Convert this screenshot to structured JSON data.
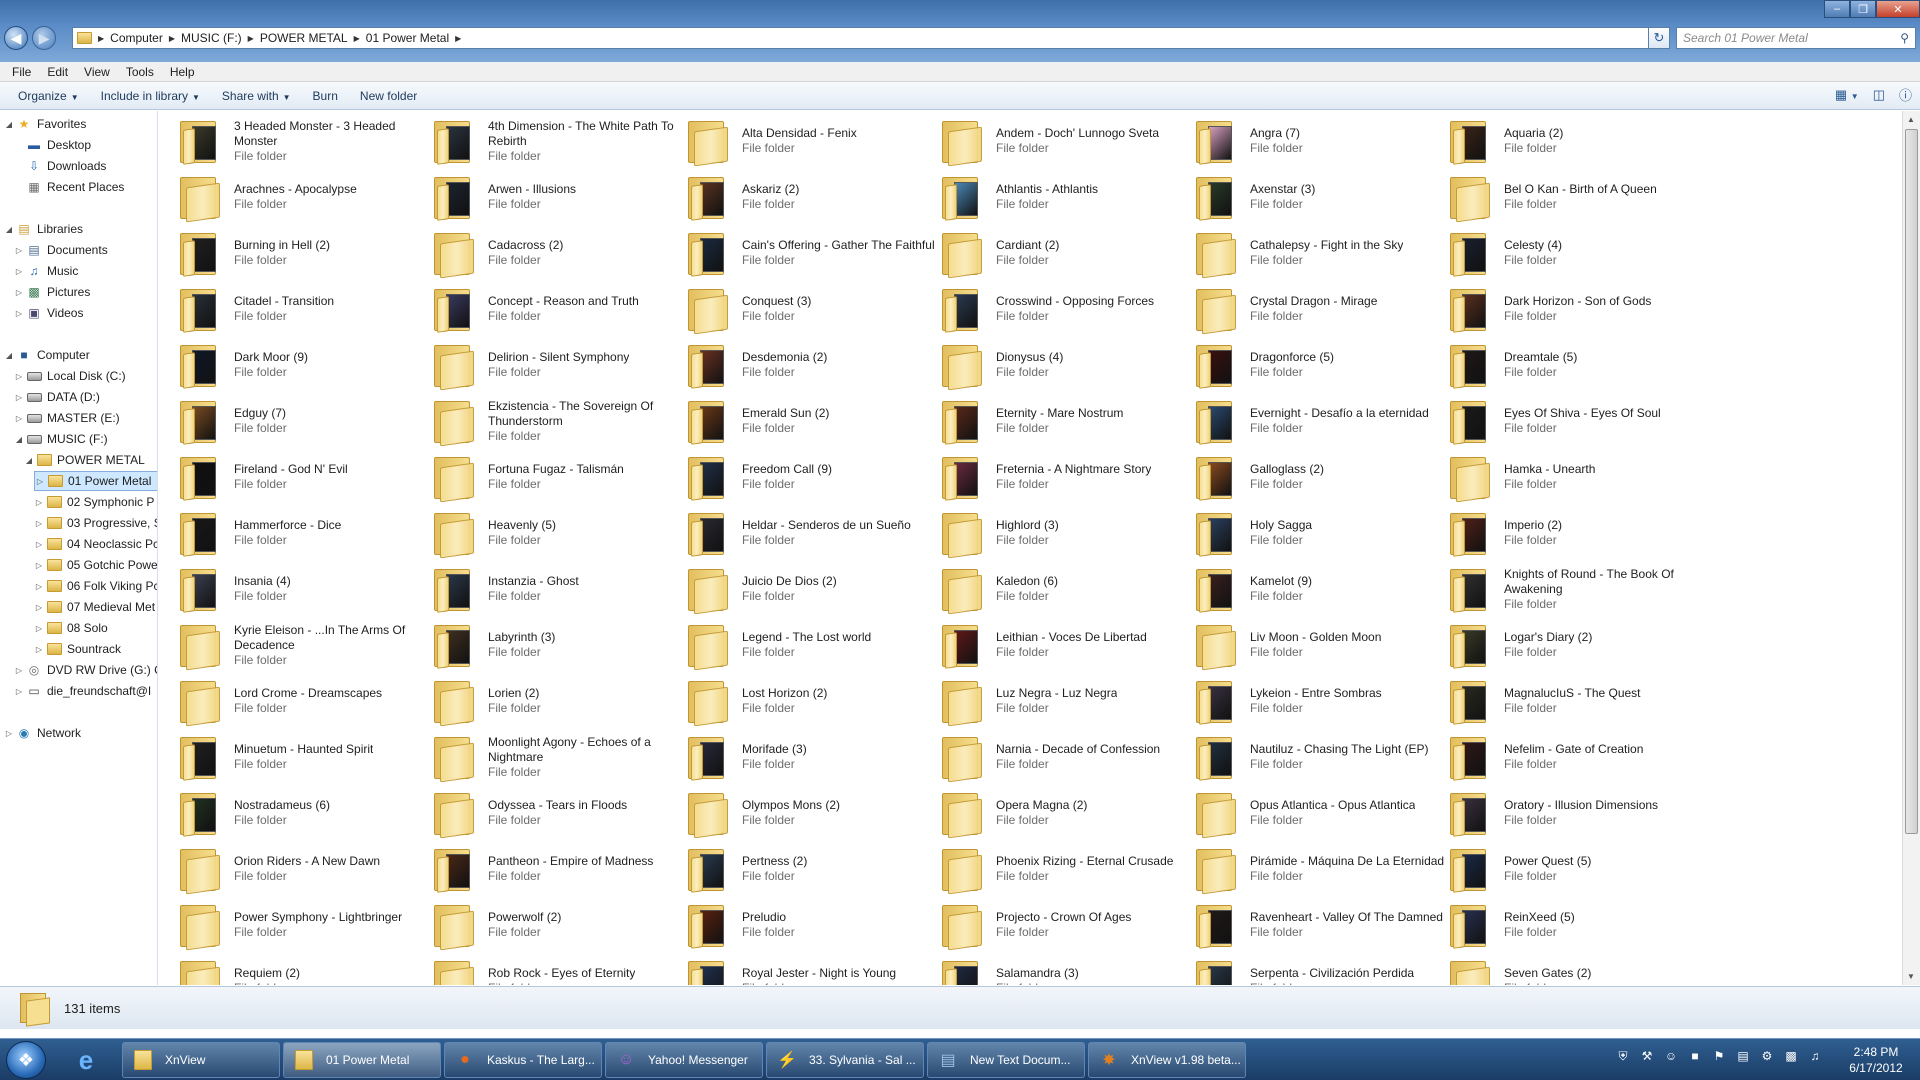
{
  "window": {
    "breadcrumb": [
      "Computer",
      "MUSIC (F:)",
      "POWER METAL",
      "01 Power Metal"
    ],
    "search_placeholder": "Search 01 Power Metal"
  },
  "menubar": [
    "File",
    "Edit",
    "View",
    "Tools",
    "Help"
  ],
  "commandbar": [
    {
      "label": "Organize",
      "dropdown": true
    },
    {
      "label": "Include in library",
      "dropdown": true
    },
    {
      "label": "Share with",
      "dropdown": true
    },
    {
      "label": "Burn",
      "dropdown": false
    },
    {
      "label": "New folder",
      "dropdown": false
    }
  ],
  "nav_tree": [
    {
      "label": "Favorites",
      "level": 0,
      "expander": "open",
      "icon": "star-icon"
    },
    {
      "label": "Desktop",
      "level": 1,
      "expander": "",
      "icon": "desktop-icon"
    },
    {
      "label": "Downloads",
      "level": 1,
      "expander": "",
      "icon": "downloads-icon"
    },
    {
      "label": "Recent Places",
      "level": 1,
      "expander": "",
      "icon": "recent-places-icon"
    },
    {
      "label": "",
      "level": 0,
      "expander": "",
      "icon": ""
    },
    {
      "label": "Libraries",
      "level": 0,
      "expander": "open",
      "icon": "libraries-icon"
    },
    {
      "label": "Documents",
      "level": 1,
      "expander": "closed",
      "icon": "documents-icon"
    },
    {
      "label": "Music",
      "level": 1,
      "expander": "closed",
      "icon": "music-icon"
    },
    {
      "label": "Pictures",
      "level": 1,
      "expander": "closed",
      "icon": "pictures-icon"
    },
    {
      "label": "Videos",
      "level": 1,
      "expander": "closed",
      "icon": "videos-icon"
    },
    {
      "label": "",
      "level": 0,
      "expander": "",
      "icon": ""
    },
    {
      "label": "Computer",
      "level": 0,
      "expander": "open",
      "icon": "computer-icon"
    },
    {
      "label": "Local Disk (C:)",
      "level": 1,
      "expander": "closed",
      "icon": "drive-icon"
    },
    {
      "label": "DATA (D:)",
      "level": 1,
      "expander": "closed",
      "icon": "drive-icon"
    },
    {
      "label": "MASTER (E:)",
      "level": 1,
      "expander": "closed",
      "icon": "drive-icon"
    },
    {
      "label": "MUSIC (F:)",
      "level": 1,
      "expander": "open",
      "icon": "drive-icon"
    },
    {
      "label": "POWER METAL",
      "level": 2,
      "expander": "open",
      "icon": "folder-icon"
    },
    {
      "label": "01 Power Metal",
      "level": 3,
      "expander": "closed",
      "icon": "folder-icon",
      "selected": true
    },
    {
      "label": "02 Symphonic P",
      "level": 3,
      "expander": "closed",
      "icon": "folder-icon"
    },
    {
      "label": "03 Progressive, S",
      "level": 3,
      "expander": "closed",
      "icon": "folder-icon"
    },
    {
      "label": "04 Neoclassic Pc",
      "level": 3,
      "expander": "closed",
      "icon": "folder-icon"
    },
    {
      "label": "05 Gotchic Powe",
      "level": 3,
      "expander": "closed",
      "icon": "folder-icon"
    },
    {
      "label": "06 Folk Viking Pc",
      "level": 3,
      "expander": "closed",
      "icon": "folder-icon"
    },
    {
      "label": "07 Medieval Met",
      "level": 3,
      "expander": "closed",
      "icon": "folder-icon"
    },
    {
      "label": "08 Solo",
      "level": 3,
      "expander": "closed",
      "icon": "folder-icon"
    },
    {
      "label": "Sountrack",
      "level": 3,
      "expander": "closed",
      "icon": "folder-icon"
    },
    {
      "label": "DVD RW Drive (G:) G",
      "level": 1,
      "expander": "closed",
      "icon": "dvd-drive-icon"
    },
    {
      "label": "die_freundschaft@I",
      "level": 1,
      "expander": "closed",
      "icon": "network-drive-icon"
    },
    {
      "label": "",
      "level": 0,
      "expander": "",
      "icon": ""
    },
    {
      "label": "Network",
      "level": 0,
      "expander": "closed",
      "icon": "network-icon"
    }
  ],
  "folder_type_label": "File folder",
  "items": [
    {
      "name": "3 Headed Monster - 3 Headed Monster",
      "art": "#3a3a2a"
    },
    {
      "name": "4th Dimension - The White Path To Rebirth",
      "art": "#2a3440"
    },
    {
      "name": "Alta Densidad - Fenix",
      "art": null
    },
    {
      "name": "Andem - Doch' Lunnogo Sveta",
      "art": null
    },
    {
      "name": "Angra (7)",
      "art": "#d8a0c0"
    },
    {
      "name": "Aquaria (2)",
      "art": "#3a2418"
    },
    {
      "name": "Arachnes - Apocalypse",
      "art": null
    },
    {
      "name": "Arwen - Illusions",
      "art": "#1c2430"
    },
    {
      "name": "Askariz (2)",
      "art": "#5a3420"
    },
    {
      "name": "Athlantis - Athlantis",
      "art": "#4a8ab8"
    },
    {
      "name": "Axenstar (3)",
      "art": "#2a3a2a"
    },
    {
      "name": "Bel O Kan - Birth of A Queen",
      "art": null
    },
    {
      "name": "Burning in Hell (2)",
      "art": "#202020"
    },
    {
      "name": "Cadacross (2)",
      "art": null
    },
    {
      "name": "Cain's Offering - Gather The Faithful",
      "art": "#1a2a40"
    },
    {
      "name": "Cardiant (2)",
      "art": null
    },
    {
      "name": "Cathalepsy - Fight in the Sky",
      "art": null
    },
    {
      "name": "Celesty (4)",
      "art": "#1a2030"
    },
    {
      "name": "Citadel - Transition",
      "art": "#283038"
    },
    {
      "name": "Concept - Reason and Truth",
      "art": "#3a3a60"
    },
    {
      "name": "Conquest (3)",
      "art": null
    },
    {
      "name": "Crosswind - Opposing Forces",
      "art": "#2a3a50"
    },
    {
      "name": "Crystal Dragon - Mirage",
      "art": null
    },
    {
      "name": "Dark Horizon - Son of Gods",
      "art": "#5a3020"
    },
    {
      "name": "Dark Moor (9)",
      "art": "#101828"
    },
    {
      "name": "Delirion - Silent Symphony",
      "art": null
    },
    {
      "name": "Desdemonia (2)",
      "art": "#6a3020"
    },
    {
      "name": "Dionysus (4)",
      "art": null
    },
    {
      "name": "Dragonforce (5)",
      "art": "#3a1010"
    },
    {
      "name": "Dreamtale (5)",
      "art": "#201818"
    },
    {
      "name": "Edguy (7)",
      "art": "#7a4a20"
    },
    {
      "name": "Ekzistencia - The Sovereign Of Thunderstorm",
      "art": null
    },
    {
      "name": "Emerald Sun (2)",
      "art": "#6a3818"
    },
    {
      "name": "Eternity - Mare Nostrum",
      "art": "#5a2818"
    },
    {
      "name": "Evernight - Desafío a la eternidad",
      "art": "#2a4a70"
    },
    {
      "name": "Eyes Of Shiva - Eyes Of Soul",
      "art": "#1a1a1a"
    },
    {
      "name": "Fireland - God N' Evil",
      "art": "#101010"
    },
    {
      "name": "Fortuna Fugaz - Talismán",
      "art": null
    },
    {
      "name": "Freedom Call (9)",
      "art": "#203048"
    },
    {
      "name": "Freternia - A Nightmare Story",
      "art": "#6a2a40"
    },
    {
      "name": "Galloglass (2)",
      "art": "#8a4a20"
    },
    {
      "name": "Hamka - Unearth",
      "art": null
    },
    {
      "name": "Hammerforce - Dice",
      "art": "#181818"
    },
    {
      "name": "Heavenly (5)",
      "art": null
    },
    {
      "name": "Heldar - Senderos de un Sueño",
      "art": "#282830"
    },
    {
      "name": "Highlord (3)",
      "art": null
    },
    {
      "name": "Holy Sagga",
      "art": "#2a4060"
    },
    {
      "name": "Imperio (2)",
      "art": "#502018"
    },
    {
      "name": "Insania (4)",
      "art": "#3a4050"
    },
    {
      "name": "Instanzia - Ghost",
      "art": "#2a3848"
    },
    {
      "name": "Juicio De Dios (2)",
      "art": null
    },
    {
      "name": "Kaledon (6)",
      "art": null
    },
    {
      "name": "Kamelot (9)",
      "art": "#3a2020"
    },
    {
      "name": "Knights of Round - The Book Of Awakening",
      "art": "#303030"
    },
    {
      "name": "Kyrie Eleison - ...In The Arms Of Decadence",
      "art": null
    },
    {
      "name": "Labyrinth (3)",
      "art": "#403020"
    },
    {
      "name": "Legend - The Lost world",
      "art": null
    },
    {
      "name": "Leithian - Voces De Libertad",
      "art": "#601818"
    },
    {
      "name": "Liv Moon - Golden Moon",
      "art": null
    },
    {
      "name": "Logar's Diary (2)",
      "art": "#3a3a28"
    },
    {
      "name": "Lord Crome - Dreamscapes",
      "art": null
    },
    {
      "name": "Lorien (2)",
      "art": null
    },
    {
      "name": "Lost Horizon (2)",
      "art": null
    },
    {
      "name": "Luz Negra - Luz Negra",
      "art": null
    },
    {
      "name": "Lykeion - Entre Sombras",
      "art": "#383040"
    },
    {
      "name": "MagnalucIuS - The Quest",
      "art": "#2a2a20"
    },
    {
      "name": "Minuetum - Haunted Spirit",
      "art": "#202020"
    },
    {
      "name": "Moonlight Agony - Echoes of a Nightmare",
      "art": null
    },
    {
      "name": "Morifade (3)",
      "art": "#28283a"
    },
    {
      "name": "Narnia - Decade of Confession",
      "art": null
    },
    {
      "name": "Nautiluz - Chasing The Light (EP)",
      "art": "#203040"
    },
    {
      "name": "Nefelim - Gate of Creation",
      "art": "#301818"
    },
    {
      "name": "Nostradameus (6)",
      "art": "#203020"
    },
    {
      "name": "Odyssea - Tears in Floods",
      "art": null
    },
    {
      "name": "Olympos Mons (2)",
      "art": null
    },
    {
      "name": "Opera Magna (2)",
      "art": null
    },
    {
      "name": "Opus Atlantica - Opus Atlantica",
      "art": null
    },
    {
      "name": "Oratory - Illusion Dimensions",
      "art": "#3a3040"
    },
    {
      "name": "Orion Riders - A New Dawn",
      "art": null
    },
    {
      "name": "Pantheon - Empire of Madness",
      "art": "#4a2818"
    },
    {
      "name": "Pertness (2)",
      "art": "#283a50"
    },
    {
      "name": "Phoenix Rizing - Eternal Crusade",
      "art": null
    },
    {
      "name": "Pirámide - Máquina De La Eternidad",
      "art": null
    },
    {
      "name": "Power Quest (5)",
      "art": "#1a2a48"
    },
    {
      "name": "Power Symphony - Lightbringer",
      "art": null
    },
    {
      "name": "Powerwolf (2)",
      "art": null
    },
    {
      "name": "Preludio",
      "art": "#5a2010"
    },
    {
      "name": "Projecto - Crown Of Ages",
      "art": null
    },
    {
      "name": "Ravenheart - Valley Of The Damned",
      "art": "#201818"
    },
    {
      "name": "ReinXeed (5)",
      "art": "#283050"
    },
    {
      "name": "Requiem (2)",
      "art": null
    },
    {
      "name": "Rob Rock - Eyes of Eternity",
      "art": null
    },
    {
      "name": "Royal Jester - Night is Young",
      "art": "#203050"
    },
    {
      "name": "Salamandra (3)",
      "art": "#202840"
    },
    {
      "name": "Serpenta - Civilización Perdida",
      "art": "#283848"
    },
    {
      "name": "Seven Gates (2)",
      "art": null
    }
  ],
  "status": {
    "count": "131 items"
  },
  "taskbar": [
    {
      "label": "XnView",
      "icon": "folder-icon",
      "active": false
    },
    {
      "label": "01 Power Metal",
      "icon": "folder-icon",
      "active": true
    },
    {
      "label": "Kaskus - The Larg...",
      "icon": "firefox-icon",
      "active": false
    },
    {
      "label": "Yahoo! Messenger",
      "icon": "yahoo-messenger-icon",
      "active": false
    },
    {
      "label": "33. Sylvania - Sal ...",
      "icon": "winamp-icon",
      "active": false
    },
    {
      "label": "New Text Docum...",
      "icon": "notepad-icon",
      "active": false
    },
    {
      "label": "XnView v1.98 beta...",
      "icon": "xnview-icon",
      "active": false
    }
  ],
  "clock": {
    "time": "2:48 PM",
    "date": "6/17/2012"
  }
}
